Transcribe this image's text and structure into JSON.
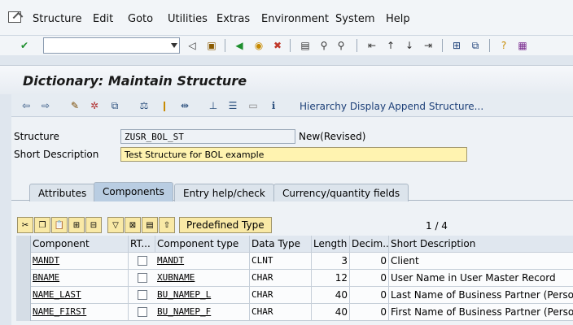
{
  "menu": [
    "Structure",
    "Edit",
    "Goto",
    "Utilities",
    "Extras",
    "Environment",
    "System",
    "Help"
  ],
  "title": "Dictionary: Maintain Structure",
  "app_toolbar": {
    "hierarchy": "Hierarchy Display",
    "append": "Append Structure..."
  },
  "form": {
    "structure_label": "Structure",
    "structure_value": "ZUSR_BOL_ST",
    "status": "New(Revised)",
    "desc_label": "Short Description",
    "desc_value": "Test Structure for BOL example"
  },
  "tabs": [
    "Attributes",
    "Components",
    "Entry help/check",
    "Currency/quantity fields"
  ],
  "table_toolbar": {
    "predefined": "Predefined Type",
    "pager": "1 / 4"
  },
  "table": {
    "headers": [
      "Component",
      "RT...",
      "Component type",
      "Data Type",
      "Length",
      "Decim...",
      "Short Description"
    ],
    "rows": [
      [
        "MANDT",
        "",
        "MANDT",
        "CLNT",
        "3",
        "0",
        "Client"
      ],
      [
        "BNAME",
        "",
        "XUBNAME",
        "CHAR",
        "12",
        "0",
        "User Name in User Master Record"
      ],
      [
        "NAME_LAST",
        "",
        "BU_NAMEP_L",
        "CHAR",
        "40",
        "0",
        "Last Name of Business Partner (Person)"
      ],
      [
        "NAME_FIRST",
        "",
        "BU_NAMEP_F",
        "CHAR",
        "40",
        "0",
        "First Name of Business Partner (Person)"
      ]
    ]
  },
  "colors": {
    "accent": "#1c3f78",
    "yellow_field": "#fff3b0",
    "active_tab": "#b9cde2"
  }
}
